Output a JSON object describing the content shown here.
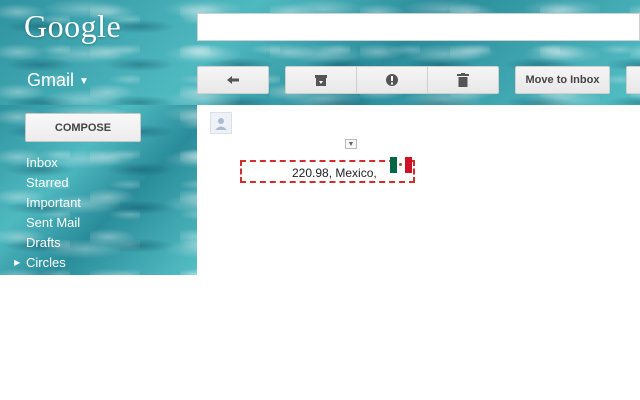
{
  "brand": {
    "logo": "Google",
    "app_label": "Gmail"
  },
  "toolbar": {
    "reply_icon": "reply-arrow-icon",
    "archive_icon": "archive-icon",
    "spam_icon": "report-spam-icon",
    "delete_icon": "trash-icon",
    "move_to_inbox_label": "Move to Inbox"
  },
  "sidebar": {
    "compose_label": "COMPOSE",
    "items": [
      {
        "label": "Inbox"
      },
      {
        "label": "Starred"
      },
      {
        "label": "Important"
      },
      {
        "label": "Sent Mail"
      },
      {
        "label": "Drafts"
      },
      {
        "label": "Circles"
      }
    ]
  },
  "message": {
    "text": "220.98, Mexico,",
    "flag": "mexico-flag-icon"
  },
  "colors": {
    "highlight_border": "#d42b2b",
    "theme": "#3aa6b0"
  }
}
